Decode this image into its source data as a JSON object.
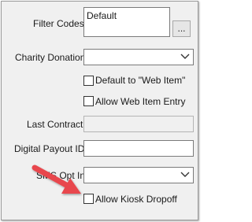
{
  "form": {
    "filter_codes_label": "Filter Codes",
    "filter_codes_value": "Default",
    "browse_label": "...",
    "charity_donation_label": "Charity Donation",
    "charity_donation_value": "",
    "default_web_item_label": "Default to \"Web Item\"",
    "default_web_item_checked": false,
    "allow_web_item_entry_label": "Allow Web Item Entry",
    "allow_web_item_entry_checked": false,
    "last_contract_label": "Last Contract",
    "last_contract_value": "",
    "digital_payout_id_label": "Digital Payout ID",
    "digital_payout_id_value": "",
    "sms_opt_in_label": "SMS Opt In",
    "sms_opt_in_value": "",
    "allow_kiosk_dropoff_label": "Allow Kiosk Dropoff",
    "allow_kiosk_dropoff_checked": false
  },
  "annotation": {
    "arrow_color": "#e8474d",
    "arrow_icon": "red-pointer-arrow"
  },
  "icons": {
    "dropdown": "chevron-down-icon"
  }
}
